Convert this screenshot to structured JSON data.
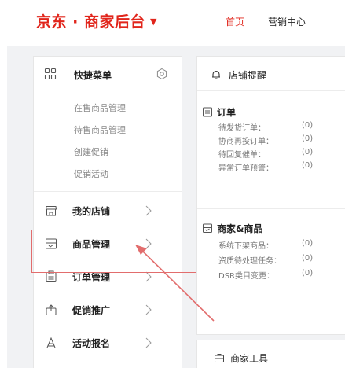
{
  "header": {
    "brand": "京东 · 商家后台",
    "brand_caret": "▼",
    "nav": {
      "home": "首页",
      "marketing": "营销中心"
    }
  },
  "quick_menu": {
    "title": "快捷菜单",
    "items": [
      "在售商品管理",
      "待售商品管理",
      "创建促销",
      "促销活动"
    ]
  },
  "menu": {
    "items": [
      {
        "label": "我的店铺",
        "icon": "shop-icon"
      },
      {
        "label": "商品管理",
        "icon": "product-icon"
      },
      {
        "label": "订单管理",
        "icon": "order-icon"
      },
      {
        "label": "促销推广",
        "icon": "promotion-icon"
      },
      {
        "label": "活动报名",
        "icon": "activity-icon"
      }
    ]
  },
  "reminders": {
    "title": "店铺提醒",
    "orders": {
      "title": "订单",
      "rows": [
        {
          "label": "待发货订单：",
          "value": "(0)"
        },
        {
          "label": "协商再投订单：",
          "value": "(0)"
        },
        {
          "label": "待回复催单：",
          "value": "(0)"
        },
        {
          "label": "异常订单预警：",
          "value": "(0)"
        }
      ]
    },
    "merchant": {
      "title": "商家&商品",
      "rows": [
        {
          "label": "系统下架商品：",
          "value": "(0)"
        },
        {
          "label": "资质待处理任务：",
          "value": "(0)"
        },
        {
          "label": "DSR类目变更：",
          "value": "(0)"
        }
      ]
    }
  },
  "tools": {
    "title": "商家工具"
  },
  "colors": {
    "brand": "#e1251b",
    "annotation": "#e26d6d",
    "background": "#f1f2f4"
  }
}
